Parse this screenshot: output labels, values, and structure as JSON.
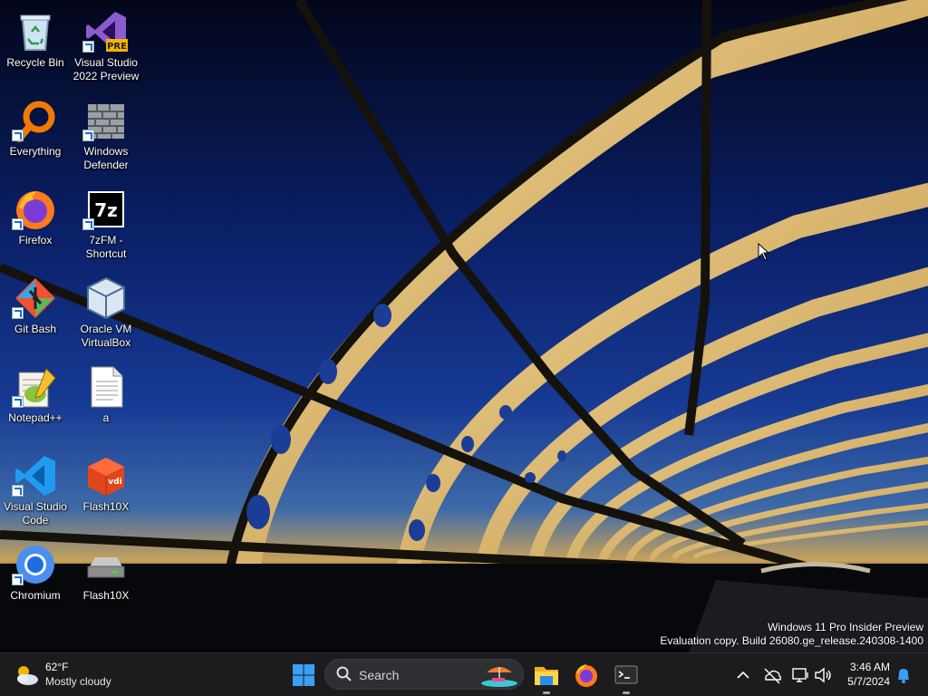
{
  "desktop": {
    "icons": [
      {
        "label": "Recycle Bin",
        "icon": "recycle-bin-icon"
      },
      {
        "label": "Visual Studio 2022 Preview",
        "icon": "visual-studio-preview-icon",
        "badge": "PRE"
      },
      {
        "label": "Everything",
        "icon": "everything-search-icon"
      },
      {
        "label": "Windows Defender",
        "icon": "windows-defender-icon"
      },
      {
        "label": "Firefox",
        "icon": "firefox-icon"
      },
      {
        "label": "7zFM - Shortcut",
        "icon": "7zip-icon",
        "glyph": "7z"
      },
      {
        "label": "Git Bash",
        "icon": "git-bash-icon"
      },
      {
        "label": "Oracle VM VirtualBox",
        "icon": "virtualbox-icon"
      },
      {
        "label": "Notepad++",
        "icon": "notepadpp-icon"
      },
      {
        "label": "a",
        "icon": "text-file-icon"
      },
      {
        "label": "Visual Studio Code",
        "icon": "vscode-icon"
      },
      {
        "label": "Flash10X",
        "icon": "flash10x-cube-icon",
        "glyph": "vdi"
      },
      {
        "label": "Chromium",
        "icon": "chromium-icon"
      },
      {
        "label": "Flash10X",
        "icon": "drive-icon"
      }
    ]
  },
  "watermark": {
    "line1": "Windows 11 Pro Insider Preview",
    "line2": "Evaluation copy. Build 26080.ge_release.240308-1400"
  },
  "taskbar": {
    "weather": {
      "temp": "62°F",
      "condition": "Mostly cloudy",
      "icon": "partly-cloudy-icon"
    },
    "start_icon": "windows-start-icon",
    "search": {
      "placeholder": "Search"
    },
    "apps": [
      {
        "name": "File Explorer",
        "icon": "file-explorer-icon"
      },
      {
        "name": "Firefox",
        "icon": "firefox-icon"
      },
      {
        "name": "Terminal",
        "icon": "terminal-icon"
      }
    ],
    "tray": {
      "icons": [
        "chevron-up-icon",
        "network-off-icon",
        "display-icon",
        "volume-icon"
      ],
      "time": "3:46 AM",
      "date": "5/7/2024",
      "notification_icon": "bell-icon"
    }
  },
  "colors": {
    "taskbar_bg": "#1c1c1e",
    "accent": "#0078d4",
    "sky_top": "#061a4c"
  }
}
